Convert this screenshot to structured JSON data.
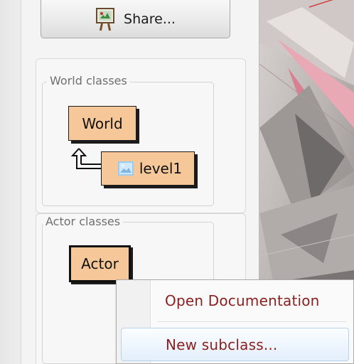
{
  "toolbar": {
    "share_label": "Share...",
    "share_icon": "easel-icon"
  },
  "world_classes": {
    "legend": "World classes",
    "classes": [
      {
        "label": "World"
      },
      {
        "label": "level1",
        "icon": "image-icon"
      }
    ]
  },
  "actor_classes": {
    "legend": "Actor classes",
    "classes": [
      {
        "label": "Actor",
        "selected": true
      }
    ]
  },
  "context_menu": {
    "items": [
      {
        "label": "Open Documentation"
      },
      {
        "label": "New subclass...",
        "highlighted": true
      }
    ]
  },
  "colors": {
    "class_box_fill": "#f6c899",
    "menu_text": "#8a2121",
    "menu_highlight": "#e3effc"
  }
}
